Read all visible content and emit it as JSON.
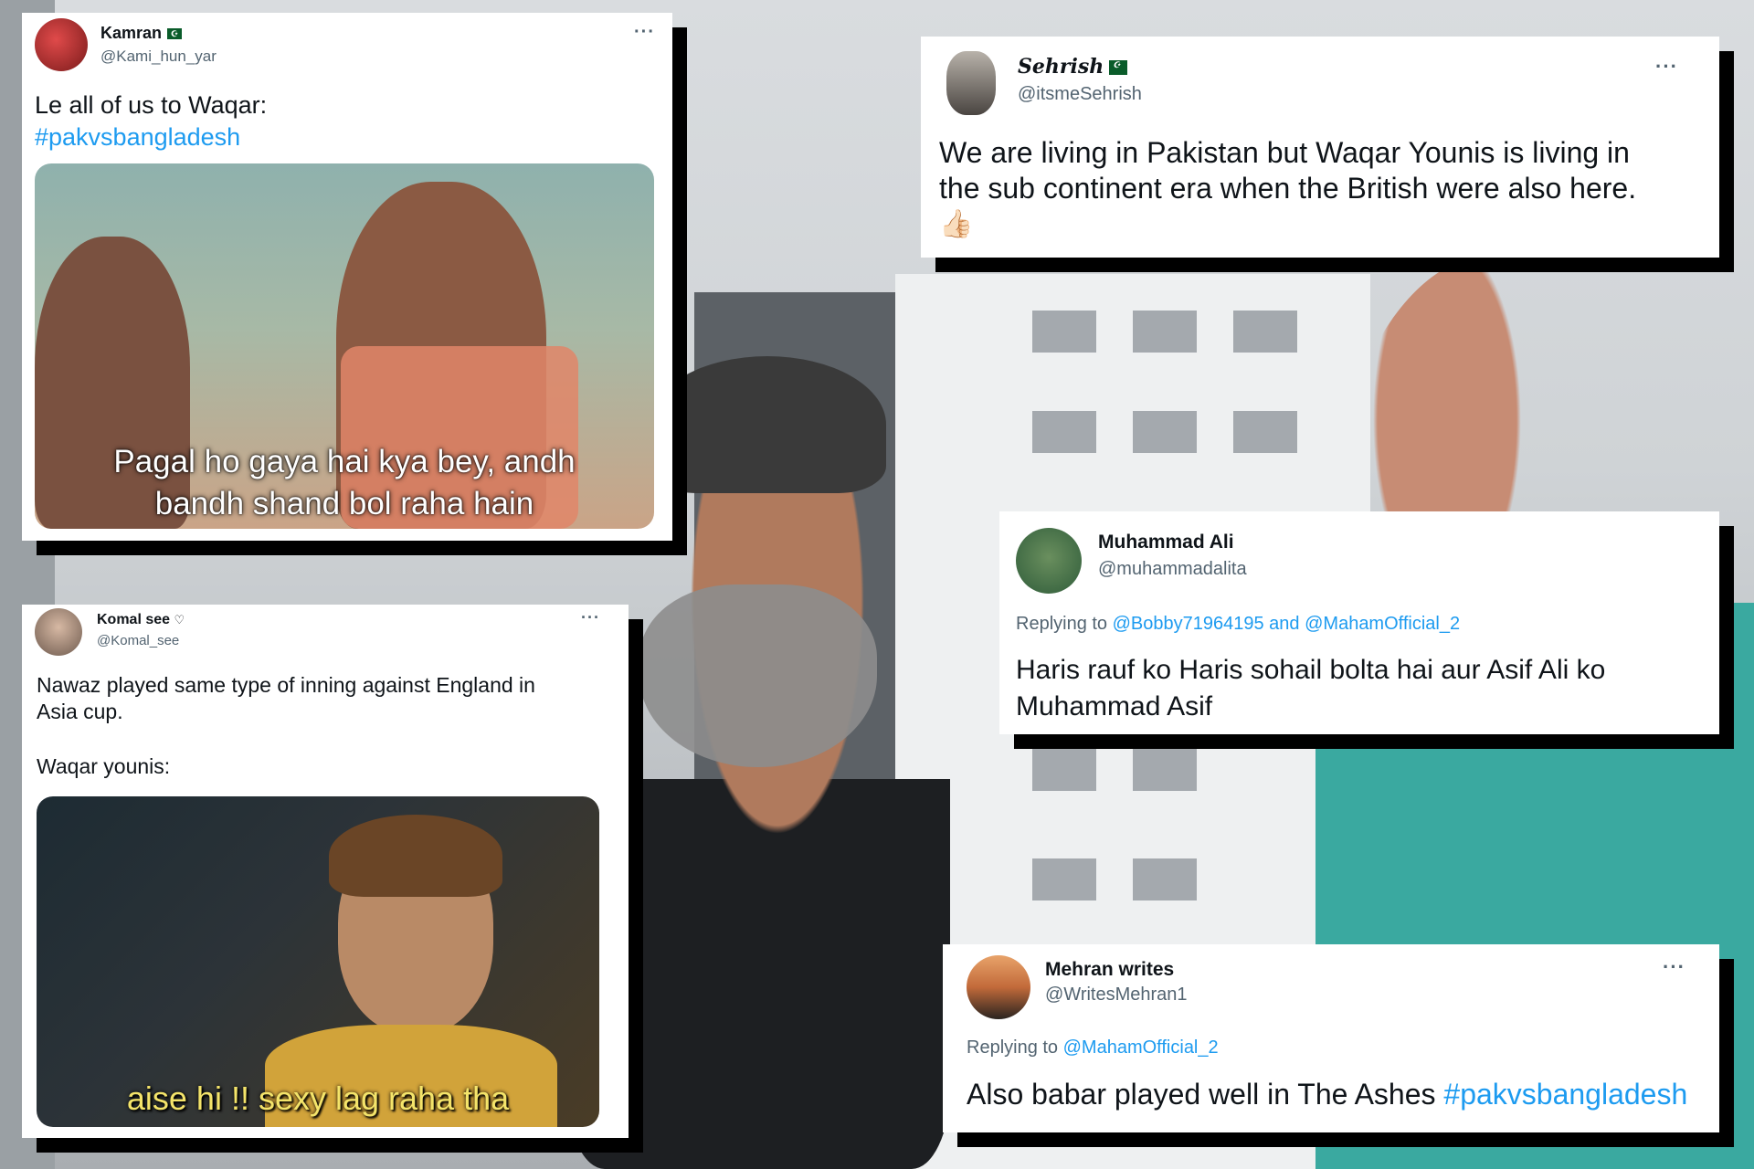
{
  "tweets": [
    {
      "name": "Kamran",
      "handle": "@Kami_hun_yar",
      "more": "···",
      "text": "Le all of us to Waqar:",
      "hashtag": "#pakvsbangladesh",
      "media_caption_line1": "Pagal ho gaya hai kya bey, andh",
      "media_caption_line2": "bandh shand bol raha hain"
    },
    {
      "name": "Komal see",
      "heart": "♡",
      "handle": "@Komal_see",
      "more": "···",
      "text_line1": "Nawaz played same type of inning against England in",
      "text_line2": "Asia cup.",
      "text_line3": "Waqar younis:",
      "media_caption": "aise hi !! sexy lag raha tha"
    },
    {
      "name": "Sehrish",
      "handle": "@itsmeSehrish",
      "more": "···",
      "text_line1": "We are living in Pakistan but Waqar Younis is living in",
      "text_line2": "the sub continent era when the British were also here.",
      "emoji": "👍🏻"
    },
    {
      "name": "Muhammad Ali",
      "handle": "@muhammadalita",
      "reply_prefix": "Replying to",
      "reply_to": "@Bobby71964195 and @MahamOfficial_2",
      "text_line1": "Haris rauf ko Haris sohail bolta hai aur Asif Ali ko",
      "text_line2": "Muhammad Asif"
    },
    {
      "name": "Mehran writes",
      "handle": "@WritesMehran1",
      "more": "···",
      "reply_prefix": "Replying to",
      "reply_to": "@MahamOfficial_2",
      "text": "Also babar played well in The Ashes",
      "hashtag": "#pakvsbangladesh"
    }
  ],
  "colors": {
    "link": "#1d9bf0",
    "shadow": "#000000",
    "card": "#ffffff"
  }
}
